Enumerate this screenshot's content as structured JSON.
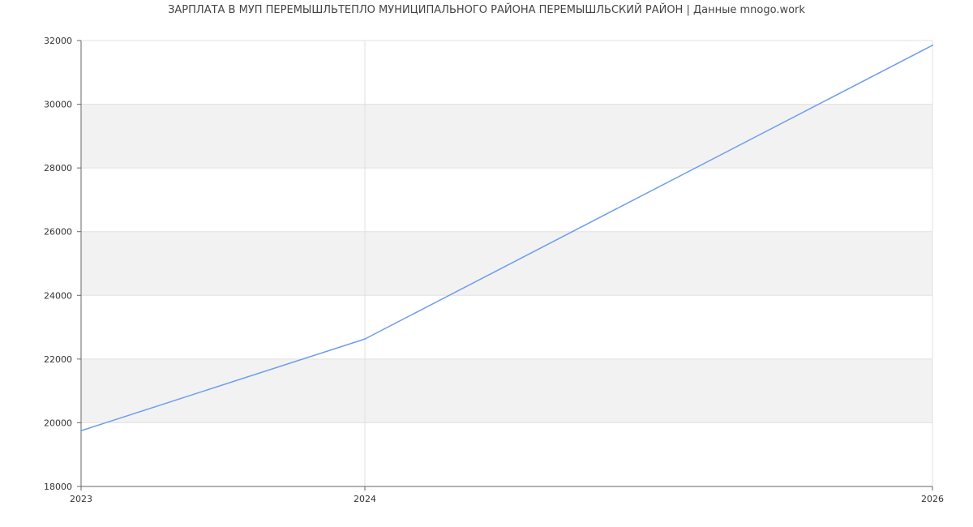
{
  "chart_data": {
    "type": "line",
    "title": "ЗАРПЛАТА В МУП ПЕРЕМЫШЛЬТЕПЛО МУНИЦИПАЛЬНОГО РАЙОНА ПЕРЕМЫШЛЬСКИЙ РАЙОН | Данные mnogo.work",
    "xlabel": "",
    "ylabel": "",
    "x_ticks": [
      "2023",
      "2024",
      "2026"
    ],
    "y_ticks": [
      18000,
      20000,
      22000,
      24000,
      26000,
      28000,
      30000,
      32000
    ],
    "ylim": [
      18000,
      32000
    ],
    "grid": true,
    "band_color": "#f2f2f2",
    "grid_color": "#e0e0e0",
    "axis_color": "#666666",
    "series": [
      {
        "color": "#6d9eeb",
        "points": [
          {
            "x": "2023",
            "y": 19750
          },
          {
            "x": "2024",
            "y": 22630
          },
          {
            "x": "2026",
            "y": 31850
          }
        ]
      }
    ]
  }
}
